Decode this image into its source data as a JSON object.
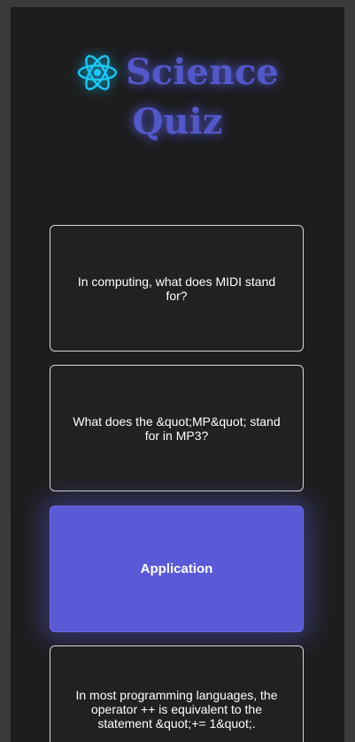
{
  "header": {
    "title_line1": "Science",
    "title_line2": "Quiz",
    "logo_icon": "react-atom-icon"
  },
  "colors": {
    "background": "#1d1d1d",
    "accent": "#5a5ad6",
    "title": "#5358c9",
    "logo": "#1fc7f5"
  },
  "cards": [
    {
      "text": "In computing, what does MIDI stand for?",
      "state": "default"
    },
    {
      "text": "What does the &quot;MP&quot; stand for in MP3?",
      "state": "default"
    },
    {
      "text": "Application",
      "state": "selected"
    },
    {
      "text": "In most programming languages, the operator ++ is equivalent to the statement &quot;+= 1&quot;.",
      "state": "default"
    }
  ]
}
